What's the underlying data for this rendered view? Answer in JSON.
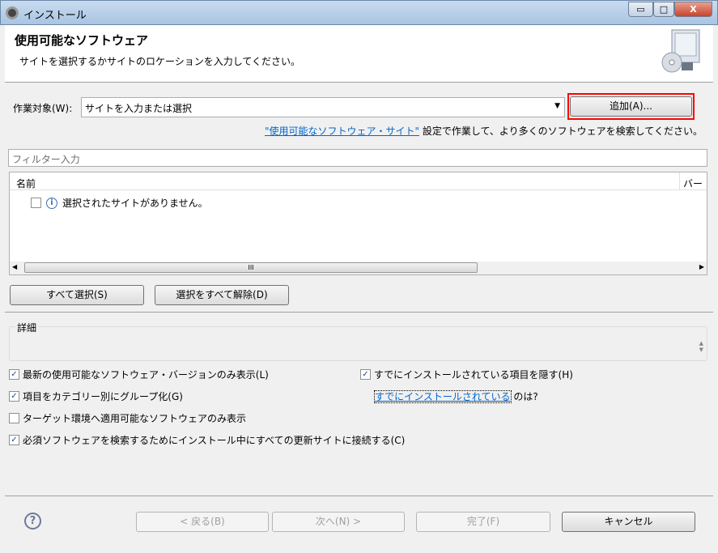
{
  "window": {
    "title": "インストール",
    "minimize": "▭",
    "maximize": "□",
    "close": "X"
  },
  "header": {
    "title": "使用可能なソフトウェア",
    "description": "サイトを選択するかサイトのロケーションを入力してください。"
  },
  "work_with": {
    "label": "作業対象(W):",
    "value": "サイトを入力または選択",
    "add_button": "追加(A)...",
    "highlight_color": "#ff0000"
  },
  "sites_line": {
    "link": "\"使用可能なソフトウェア・サイト\"",
    "rest": " 設定で作業して、より多くのソフトウェアを検索してください。"
  },
  "filter": {
    "placeholder": "フィルター入力"
  },
  "table": {
    "columns": [
      "名前",
      "バージ"
    ],
    "rows": [
      {
        "checked": false,
        "icon": "info-icon",
        "text": "選択されたサイトがありません。"
      }
    ],
    "scroll_grip": "III"
  },
  "buttons": {
    "select_all": "すべて選択(S)",
    "deselect_all": "選択をすべて解除(D)"
  },
  "details": {
    "label": "詳細"
  },
  "options": [
    {
      "label": "最新の使用可能なソフトウェア・バージョンのみ表示(L)",
      "checked": true
    },
    {
      "label": "項目をカテゴリー別にグループ化(G)",
      "checked": true
    },
    {
      "label": "ターゲット環境へ適用可能なソフトウェアのみ表示",
      "checked": false
    },
    {
      "label": "必須ソフトウェアを検索するためにインストール中にすべての更新サイトに接続する(C)",
      "checked": true
    },
    {
      "label": "すでにインストールされている項目を隠す(H)",
      "checked": true
    }
  ],
  "installed_link": {
    "link": "すでにインストールされている",
    "rest": " のは?"
  },
  "footer": {
    "back": "< 戻る(B)",
    "next": "次へ(N) >",
    "finish": "完了(F)",
    "cancel": "キャンセル",
    "help": "?"
  }
}
